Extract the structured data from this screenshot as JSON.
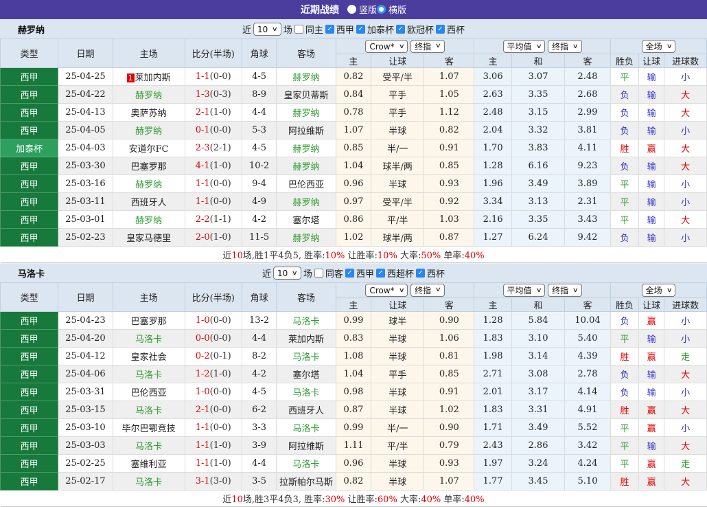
{
  "title_bar": {
    "title": "近期战绩",
    "radios": [
      {
        "label": "竖版",
        "selected": false
      },
      {
        "label": "横版",
        "selected": true
      }
    ]
  },
  "colors": {
    "accent_purple": "#4b3d9e",
    "panel_blue": "#dce6f1",
    "type_dark_green": "#17793b",
    "type_light_green": "#2d9f5e",
    "team_green": "#2f9b2f",
    "score_red": "#e60000",
    "result_blue": "#3333cc",
    "checkbox_blue": "#2b87f0"
  },
  "filter_common": {
    "near_label": "近",
    "games_label": "场"
  },
  "table_headers": {
    "cols": [
      "类型",
      "日期",
      "主场",
      "比分(半场)",
      "角球",
      "客场"
    ],
    "odds_dropdowns": [
      "Crow*",
      "终指"
    ],
    "avg_dropdowns": [
      "平均值",
      "终指"
    ],
    "result_dropdown": "全场",
    "odds_sub": [
      "主",
      "让球",
      "客"
    ],
    "avg_sub": [
      "主",
      "和",
      "客"
    ],
    "result_sub": [
      "胜负",
      "让球",
      "进球数"
    ]
  },
  "sections": [
    {
      "team": "赫罗纳",
      "filter": {
        "near_value": "10",
        "same_label": "同主",
        "same_checked": false,
        "leagues": [
          {
            "label": "西甲",
            "checked": true
          },
          {
            "label": "加泰杯",
            "checked": true
          },
          {
            "label": "欧冠杯",
            "checked": true
          },
          {
            "label": "西杯",
            "checked": true
          }
        ]
      },
      "rows": [
        {
          "type": "西甲",
          "type_style": "dark",
          "date": "25-04-25",
          "home": "莱加内斯",
          "home_team": false,
          "home_badge": "1",
          "score": "1-1",
          "half": "(0-0)",
          "corners": "4-5",
          "away": "赫罗纳",
          "away_team": true,
          "odds": [
            "0.82",
            "受平/半",
            "1.07"
          ],
          "avg": [
            "3.06",
            "3.07",
            "2.48"
          ],
          "results": [
            [
              "平",
              "g"
            ],
            [
              "输",
              "b"
            ],
            [
              "小",
              "b"
            ]
          ]
        },
        {
          "type": "西甲",
          "type_style": "dark",
          "date": "25-04-22",
          "home": "赫罗纳",
          "home_team": true,
          "home_badge": null,
          "score": "1-3",
          "half": "(0-3)",
          "corners": "8-9",
          "away": "皇家贝蒂斯",
          "away_team": false,
          "odds": [
            "0.84",
            "平手",
            "1.05"
          ],
          "avg": [
            "2.63",
            "3.35",
            "2.68"
          ],
          "results": [
            [
              "负",
              "b"
            ],
            [
              "输",
              "b"
            ],
            [
              "大",
              "r"
            ]
          ]
        },
        {
          "type": "西甲",
          "type_style": "dark",
          "date": "25-04-13",
          "home": "奥萨苏纳",
          "home_team": false,
          "home_badge": null,
          "score": "2-1",
          "half": "(1-0)",
          "corners": "4-4",
          "away": "赫罗纳",
          "away_team": true,
          "odds": [
            "0.78",
            "平手",
            "1.12"
          ],
          "avg": [
            "2.48",
            "3.15",
            "2.99"
          ],
          "results": [
            [
              "负",
              "b"
            ],
            [
              "输",
              "b"
            ],
            [
              "大",
              "r"
            ]
          ]
        },
        {
          "type": "西甲",
          "type_style": "dark",
          "date": "25-04-05",
          "home": "赫罗纳",
          "home_team": true,
          "home_badge": null,
          "score": "0-1",
          "half": "(0-0)",
          "corners": "5-3",
          "away": "阿拉维斯",
          "away_team": false,
          "odds": [
            "1.07",
            "半球",
            "0.82"
          ],
          "avg": [
            "2.04",
            "3.32",
            "3.81"
          ],
          "results": [
            [
              "负",
              "b"
            ],
            [
              "输",
              "b"
            ],
            [
              "小",
              "b"
            ]
          ]
        },
        {
          "type": "加泰杯",
          "type_style": "light",
          "date": "25-04-03",
          "home": "安道尔FC",
          "home_team": false,
          "home_badge": null,
          "score": "2-3",
          "half": "(2-1)",
          "corners": "4-5",
          "away": "赫罗纳",
          "away_team": true,
          "odds": [
            "0.85",
            "半/一",
            "0.91"
          ],
          "avg": [
            "1.70",
            "3.83",
            "4.11"
          ],
          "results": [
            [
              "胜",
              "r"
            ],
            [
              "赢",
              "r"
            ],
            [
              "大",
              "r"
            ]
          ]
        },
        {
          "type": "西甲",
          "type_style": "dark",
          "date": "25-03-30",
          "home": "巴塞罗那",
          "home_team": false,
          "home_badge": null,
          "score": "4-1",
          "half": "(1-0)",
          "corners": "10-2",
          "away": "赫罗纳",
          "away_team": true,
          "odds": [
            "1.04",
            "球半/两",
            "0.85"
          ],
          "avg": [
            "1.28",
            "6.16",
            "9.23"
          ],
          "results": [
            [
              "负",
              "b"
            ],
            [
              "输",
              "b"
            ],
            [
              "大",
              "r"
            ]
          ]
        },
        {
          "type": "西甲",
          "type_style": "dark",
          "date": "25-03-16",
          "home": "赫罗纳",
          "home_team": true,
          "home_badge": null,
          "score": "1-1",
          "half": "(0-0)",
          "corners": "9-4",
          "away": "巴伦西亚",
          "away_team": false,
          "odds": [
            "0.96",
            "半球",
            "0.93"
          ],
          "avg": [
            "1.96",
            "3.49",
            "3.89"
          ],
          "results": [
            [
              "平",
              "g"
            ],
            [
              "输",
              "b"
            ],
            [
              "小",
              "b"
            ]
          ]
        },
        {
          "type": "西甲",
          "type_style": "dark",
          "date": "25-03-11",
          "home": "西班牙人",
          "home_team": false,
          "home_badge": null,
          "score": "1-1",
          "half": "(0-0)",
          "corners": "4-9",
          "away": "赫罗纳",
          "away_team": true,
          "odds": [
            "0.97",
            "受平/半",
            "0.92"
          ],
          "avg": [
            "3.34",
            "3.13",
            "2.31"
          ],
          "results": [
            [
              "平",
              "g"
            ],
            [
              "输",
              "b"
            ],
            [
              "小",
              "b"
            ]
          ]
        },
        {
          "type": "西甲",
          "type_style": "dark",
          "date": "25-03-01",
          "home": "赫罗纳",
          "home_team": true,
          "home_badge": null,
          "score": "2-2",
          "half": "(1-1)",
          "corners": "4-2",
          "away": "塞尔塔",
          "away_team": false,
          "odds": [
            "0.86",
            "平/半",
            "1.03"
          ],
          "avg": [
            "2.16",
            "3.35",
            "3.43"
          ],
          "results": [
            [
              "平",
              "g"
            ],
            [
              "输",
              "b"
            ],
            [
              "大",
              "r"
            ]
          ]
        },
        {
          "type": "西甲",
          "type_style": "dark",
          "date": "25-02-23",
          "home": "皇家马德里",
          "home_team": false,
          "home_badge": null,
          "score": "2-0",
          "half": "(1-0)",
          "corners": "11-5",
          "away": "赫罗纳",
          "away_team": true,
          "odds": [
            "1.02",
            "球半/两",
            "0.87"
          ],
          "avg": [
            "1.27",
            "6.24",
            "9.42"
          ],
          "results": [
            [
              "负",
              "b"
            ],
            [
              "输",
              "b"
            ],
            [
              "小",
              "b"
            ]
          ]
        }
      ],
      "summary": [
        [
          "近",
          "k"
        ],
        [
          "10",
          "r"
        ],
        [
          "场,胜1平4负5, 胜率:",
          "k"
        ],
        [
          "10%",
          "r"
        ],
        [
          " 让胜率:",
          "k"
        ],
        [
          "10%",
          "r"
        ],
        [
          " 大率:",
          "k"
        ],
        [
          "50%",
          "r"
        ],
        [
          " 单率:",
          "k"
        ],
        [
          "40%",
          "r"
        ]
      ]
    },
    {
      "team": "马洛卡",
      "filter": {
        "near_value": "10",
        "same_label": "同客",
        "same_checked": false,
        "leagues": [
          {
            "label": "西甲",
            "checked": true
          },
          {
            "label": "西超杯",
            "checked": true
          },
          {
            "label": "西杯",
            "checked": true
          }
        ]
      },
      "rows": [
        {
          "type": "西甲",
          "type_style": "dark",
          "date": "25-04-23",
          "home": "巴塞罗那",
          "home_team": false,
          "home_badge": null,
          "score": "1-0",
          "half": "(0-0)",
          "corners": "13-2",
          "away": "马洛卡",
          "away_team": true,
          "odds": [
            "0.99",
            "球半",
            "0.90"
          ],
          "avg": [
            "1.28",
            "5.84",
            "10.04"
          ],
          "results": [
            [
              "负",
              "b"
            ],
            [
              "赢",
              "r"
            ],
            [
              "小",
              "b"
            ]
          ]
        },
        {
          "type": "西甲",
          "type_style": "dark",
          "date": "25-04-20",
          "home": "马洛卡",
          "home_team": true,
          "home_badge": null,
          "score": "0-0",
          "half": "(0-0)",
          "corners": "4-4",
          "away": "莱加内斯",
          "away_team": false,
          "odds": [
            "0.83",
            "半球",
            "1.06"
          ],
          "avg": [
            "1.83",
            "3.10",
            "5.40"
          ],
          "results": [
            [
              "平",
              "g"
            ],
            [
              "输",
              "b"
            ],
            [
              "小",
              "b"
            ]
          ]
        },
        {
          "type": "西甲",
          "type_style": "dark",
          "date": "25-04-12",
          "home": "皇家社会",
          "home_team": false,
          "home_badge": null,
          "score": "0-2",
          "half": "(0-1)",
          "corners": "8-2",
          "away": "马洛卡",
          "away_team": true,
          "odds": [
            "1.08",
            "半球",
            "0.81"
          ],
          "avg": [
            "1.98",
            "3.14",
            "4.39"
          ],
          "results": [
            [
              "胜",
              "r"
            ],
            [
              "赢",
              "r"
            ],
            [
              "走",
              "g"
            ]
          ]
        },
        {
          "type": "西甲",
          "type_style": "dark",
          "date": "25-04-06",
          "home": "马洛卡",
          "home_team": true,
          "home_badge": null,
          "score": "1-2",
          "half": "(1-0)",
          "corners": "4-2",
          "away": "塞尔塔",
          "away_team": false,
          "odds": [
            "1.04",
            "平手",
            "0.85"
          ],
          "avg": [
            "2.71",
            "3.08",
            "2.78"
          ],
          "results": [
            [
              "负",
              "b"
            ],
            [
              "输",
              "b"
            ],
            [
              "大",
              "r"
            ]
          ]
        },
        {
          "type": "西甲",
          "type_style": "dark",
          "date": "25-03-31",
          "home": "巴伦西亚",
          "home_team": false,
          "home_badge": null,
          "score": "1-0",
          "half": "(0-0)",
          "corners": "4-5",
          "away": "马洛卡",
          "away_team": true,
          "odds": [
            "0.98",
            "半球",
            "0.91"
          ],
          "avg": [
            "2.01",
            "3.17",
            "4.14"
          ],
          "results": [
            [
              "负",
              "b"
            ],
            [
              "输",
              "b"
            ],
            [
              "小",
              "b"
            ]
          ]
        },
        {
          "type": "西甲",
          "type_style": "dark",
          "date": "25-03-15",
          "home": "马洛卡",
          "home_team": true,
          "home_badge": null,
          "score": "2-1",
          "half": "(0-0)",
          "corners": "6-2",
          "away": "西班牙人",
          "away_team": false,
          "odds": [
            "0.87",
            "半球",
            "1.02"
          ],
          "avg": [
            "1.83",
            "3.31",
            "4.91"
          ],
          "results": [
            [
              "胜",
              "r"
            ],
            [
              "赢",
              "r"
            ],
            [
              "大",
              "r"
            ]
          ]
        },
        {
          "type": "西甲",
          "type_style": "dark",
          "date": "25-03-10",
          "home": "毕尔巴鄂竞技",
          "home_team": false,
          "home_badge": null,
          "score": "1-1",
          "half": "(0-0)",
          "corners": "3-3",
          "away": "马洛卡",
          "away_team": true,
          "odds": [
            "0.99",
            "半/一",
            "0.90"
          ],
          "avg": [
            "1.71",
            "3.49",
            "5.52"
          ],
          "results": [
            [
              "平",
              "g"
            ],
            [
              "赢",
              "r"
            ],
            [
              "小",
              "b"
            ]
          ]
        },
        {
          "type": "西甲",
          "type_style": "dark",
          "date": "25-03-03",
          "home": "马洛卡",
          "home_team": true,
          "home_badge": null,
          "score": "1-1",
          "half": "(1-0)",
          "corners": "3-9",
          "away": "阿拉维斯",
          "away_team": false,
          "odds": [
            "1.11",
            "平/半",
            "0.79"
          ],
          "avg": [
            "2.43",
            "2.86",
            "3.42"
          ],
          "results": [
            [
              "平",
              "g"
            ],
            [
              "输",
              "b"
            ],
            [
              "大",
              "r"
            ]
          ]
        },
        {
          "type": "西甲",
          "type_style": "dark",
          "date": "25-02-25",
          "home": "塞维利亚",
          "home_team": false,
          "home_badge": null,
          "score": "1-1",
          "half": "(1-0)",
          "corners": "4-4",
          "away": "马洛卡",
          "away_team": true,
          "odds": [
            "0.96",
            "半球",
            "0.93"
          ],
          "avg": [
            "1.97",
            "3.24",
            "4.24"
          ],
          "results": [
            [
              "平",
              "g"
            ],
            [
              "赢",
              "r"
            ],
            [
              "走",
              "g"
            ]
          ]
        },
        {
          "type": "西甲",
          "type_style": "dark",
          "date": "25-02-17",
          "home": "马洛卡",
          "home_team": true,
          "home_badge": null,
          "score": "3-1",
          "half": "(3-0)",
          "corners": "3-5",
          "away": "拉斯帕尔马斯",
          "away_team": false,
          "odds": [
            "0.82",
            "半球",
            "1.07"
          ],
          "avg": [
            "1.77",
            "3.45",
            "5.10"
          ],
          "results": [
            [
              "胜",
              "r"
            ],
            [
              "赢",
              "r"
            ],
            [
              "大",
              "r"
            ]
          ]
        }
      ],
      "summary": [
        [
          "近",
          "k"
        ],
        [
          "10",
          "r"
        ],
        [
          "场,胜3平4负3, 胜率:",
          "k"
        ],
        [
          "30%",
          "r"
        ],
        [
          " 让胜率:",
          "k"
        ],
        [
          "60%",
          "r"
        ],
        [
          " 大率:",
          "k"
        ],
        [
          "40%",
          "r"
        ],
        [
          " 单率:",
          "k"
        ],
        [
          "40%",
          "r"
        ]
      ]
    }
  ]
}
